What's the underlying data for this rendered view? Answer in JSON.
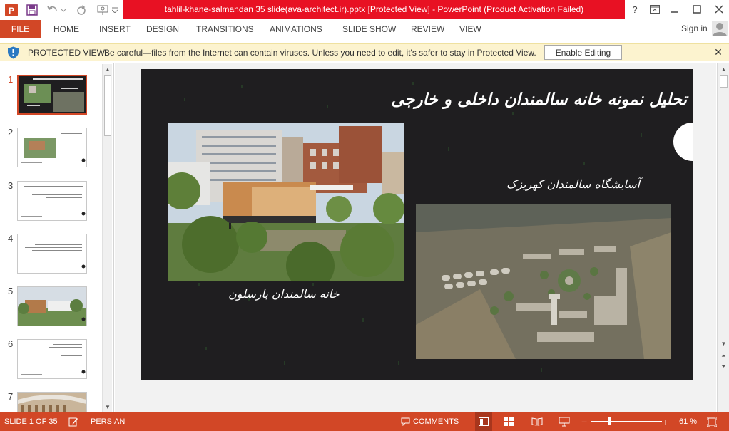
{
  "window": {
    "title": "tahlil-khane-salmandan 35 slide(ava-architect.ir).pptx [Protected View] -  PowerPoint (Product Activation Failed)",
    "help": "?"
  },
  "ribbon": {
    "file": "FILE",
    "tabs": [
      "HOME",
      "INSERT",
      "DESIGN",
      "TRANSITIONS",
      "ANIMATIONS",
      "SLIDE SHOW",
      "REVIEW",
      "VIEW"
    ],
    "sign_in": "Sign in"
  },
  "protected_view": {
    "title": "PROTECTED VIEW",
    "message": "Be careful—files from the Internet can contain viruses. Unless you need to edit, it's safer to stay in Protected View.",
    "enable_button": "Enable Editing"
  },
  "thumbnails": [
    {
      "number": "1"
    },
    {
      "number": "2"
    },
    {
      "number": "3"
    },
    {
      "number": "4"
    },
    {
      "number": "5"
    },
    {
      "number": "6"
    },
    {
      "number": "7"
    }
  ],
  "slide": {
    "title": "تحلیل نمونه خانه سالمندان داخلی و خارجی",
    "caption_right": "آسایشگاه سالمندان کهریزک",
    "caption_left": "خانه سالمندان بارسلون",
    "background_color": "#1f1e20"
  },
  "status": {
    "slide_indicator": "SLIDE 1 OF 35",
    "language": "PERSIAN",
    "comments": "COMMENTS",
    "zoom": "61 %",
    "zoom_minus": "−",
    "zoom_plus": "+"
  },
  "colors": {
    "accent": "#d24726",
    "title_bar_red": "#e81123",
    "protected_bar": "#fcf3cf"
  }
}
